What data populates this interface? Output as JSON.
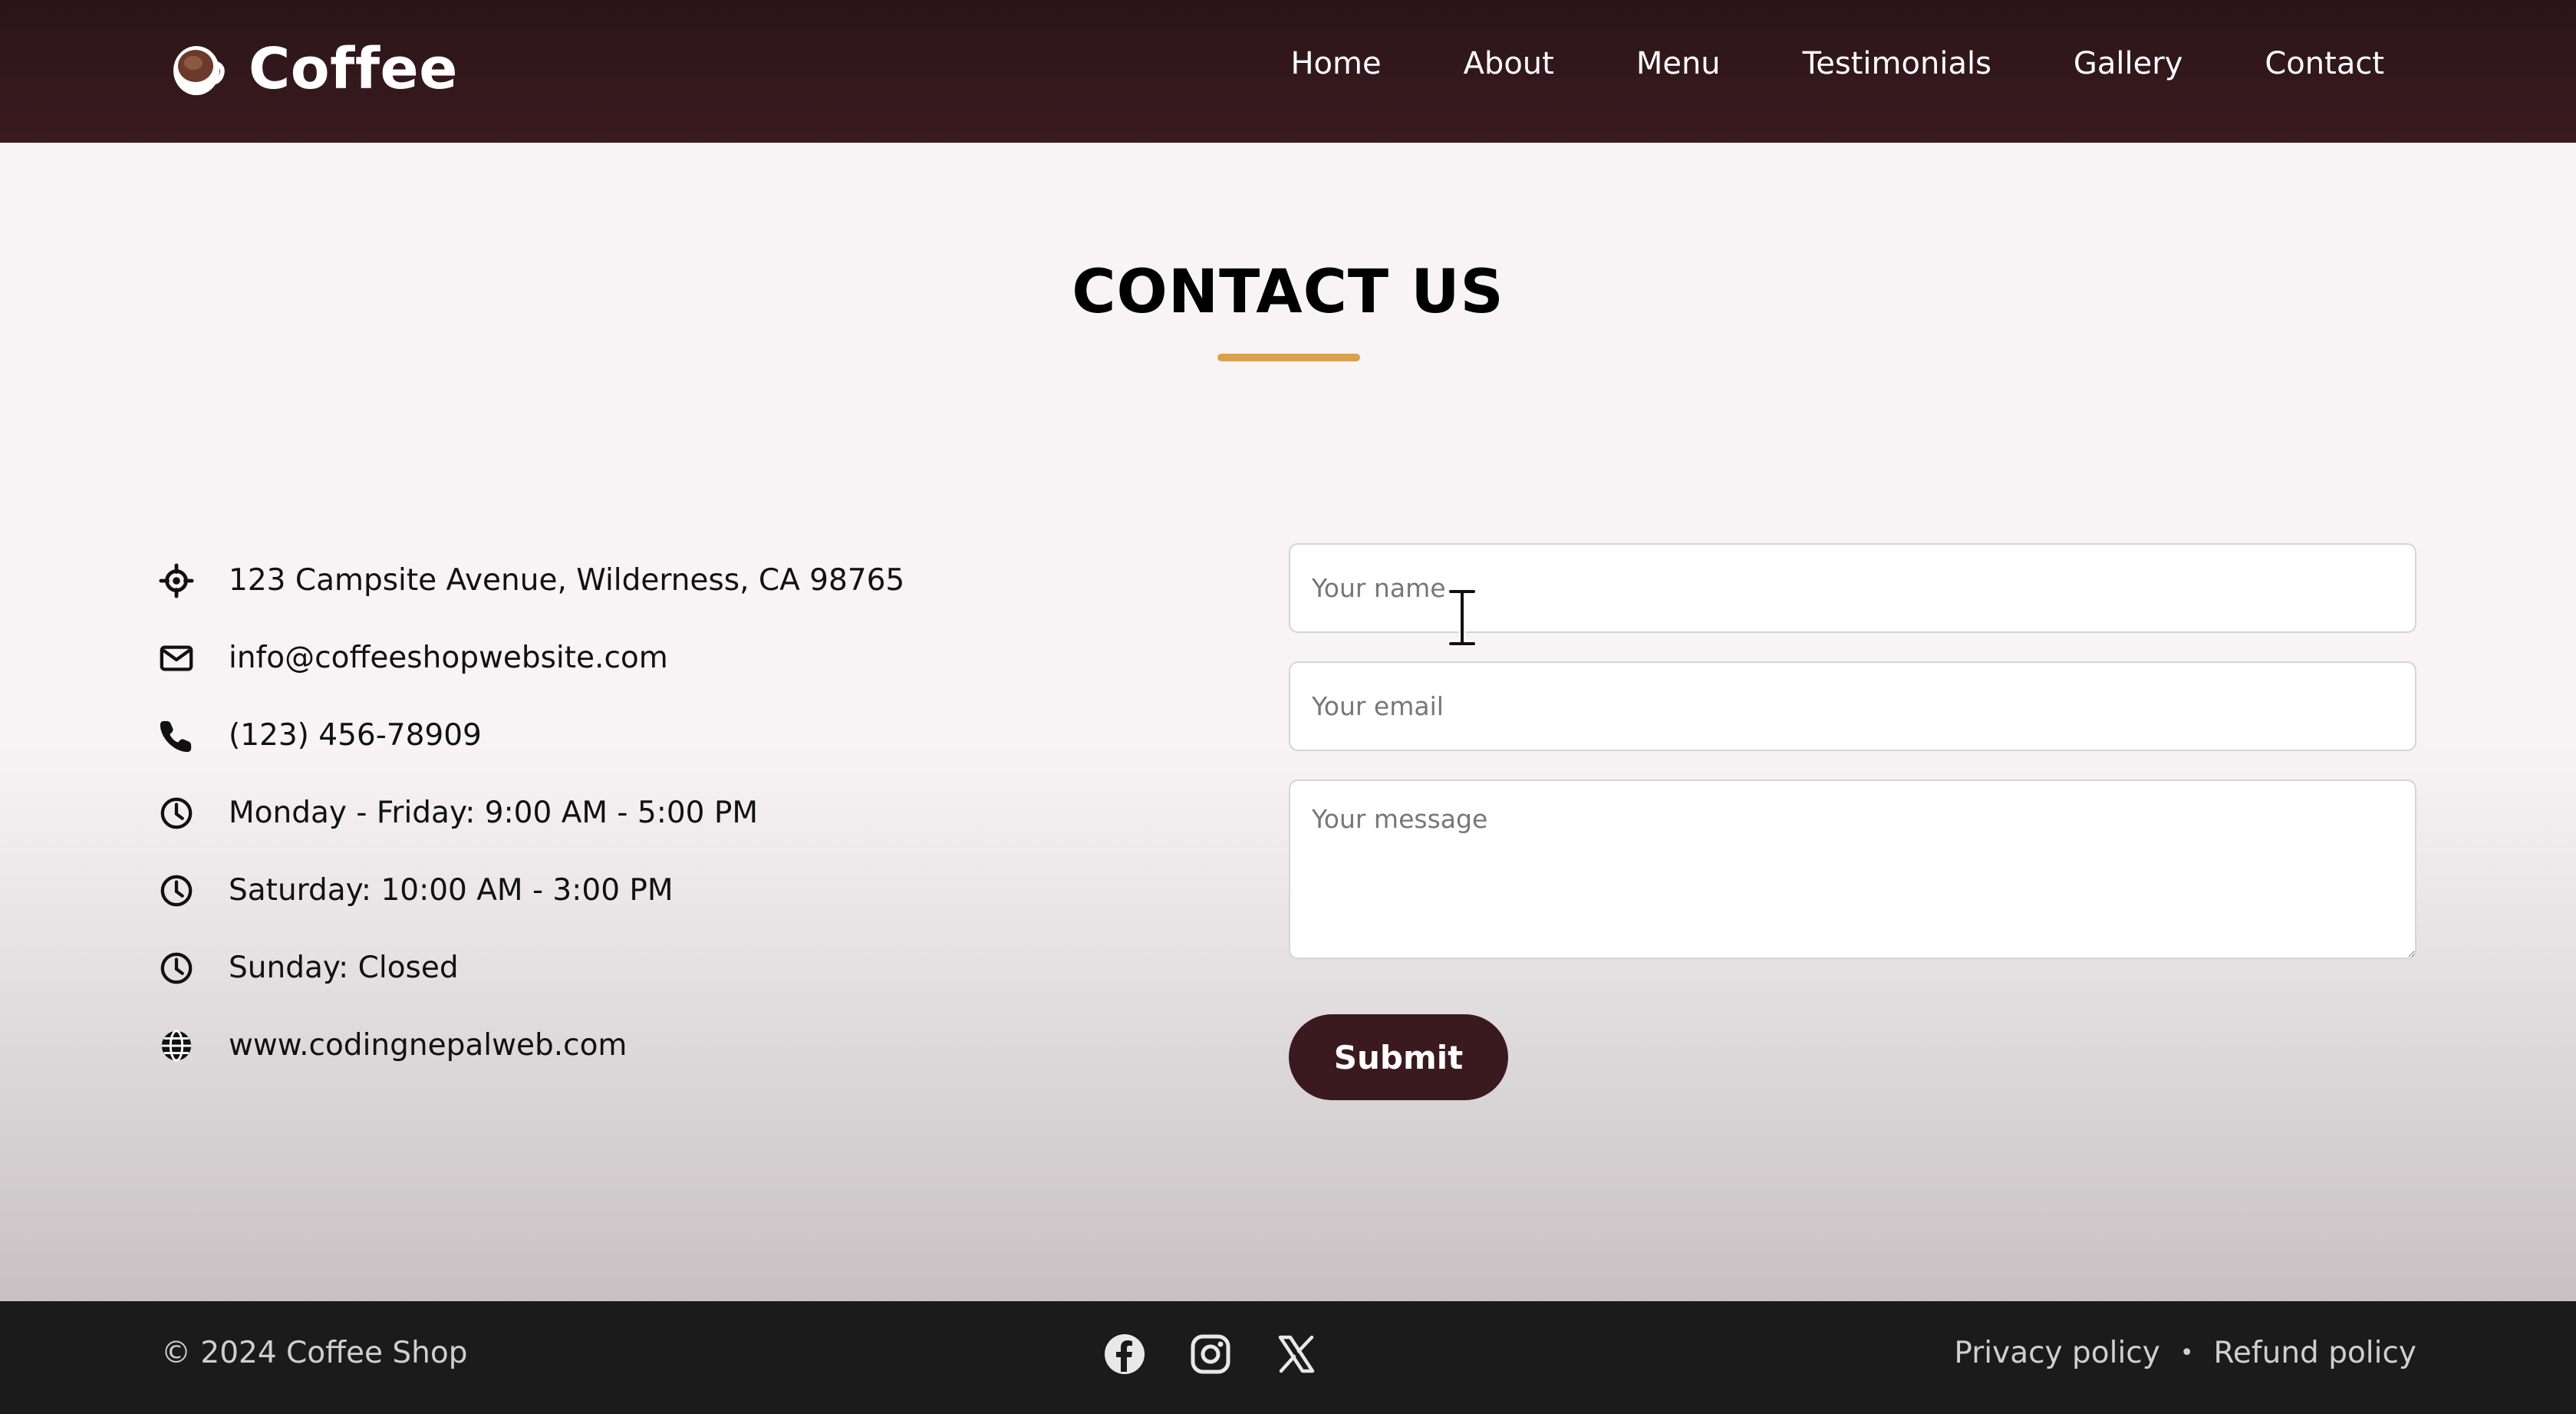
{
  "header": {
    "brand": "Coffee",
    "nav": [
      "Home",
      "About",
      "Menu",
      "Testimonials",
      "Gallery",
      "Contact"
    ]
  },
  "contact": {
    "title": "CONTACT US",
    "info": [
      {
        "icon": "location-crosshair-icon",
        "text": "123 Campsite Avenue, Wilderness, CA 98765"
      },
      {
        "icon": "envelope-icon",
        "text": "info@coffeeshopwebsite.com"
      },
      {
        "icon": "phone-icon",
        "text": "(123) 456-78909"
      },
      {
        "icon": "clock-icon",
        "text": "Monday - Friday: 9:00 AM - 5:00 PM"
      },
      {
        "icon": "clock-icon",
        "text": "Saturday: 10:00 AM - 3:00 PM"
      },
      {
        "icon": "clock-icon",
        "text": "Sunday: Closed"
      },
      {
        "icon": "globe-icon",
        "text": "www.codingnepalweb.com"
      }
    ],
    "form": {
      "name_placeholder": "Your name",
      "email_placeholder": "Your email",
      "message_placeholder": "Your message",
      "submit_label": "Submit"
    }
  },
  "footer": {
    "copyright": "© 2024 Coffee Shop",
    "social": [
      "facebook-icon",
      "instagram-icon",
      "x-icon"
    ],
    "links": [
      "Privacy policy",
      "Refund policy"
    ],
    "separator": "•"
  },
  "colors": {
    "header_bg": "#3a1a1f",
    "accent": "#d9a04e",
    "submit_bg": "#3a1a1f",
    "footer_bg": "#1b1b1b"
  }
}
